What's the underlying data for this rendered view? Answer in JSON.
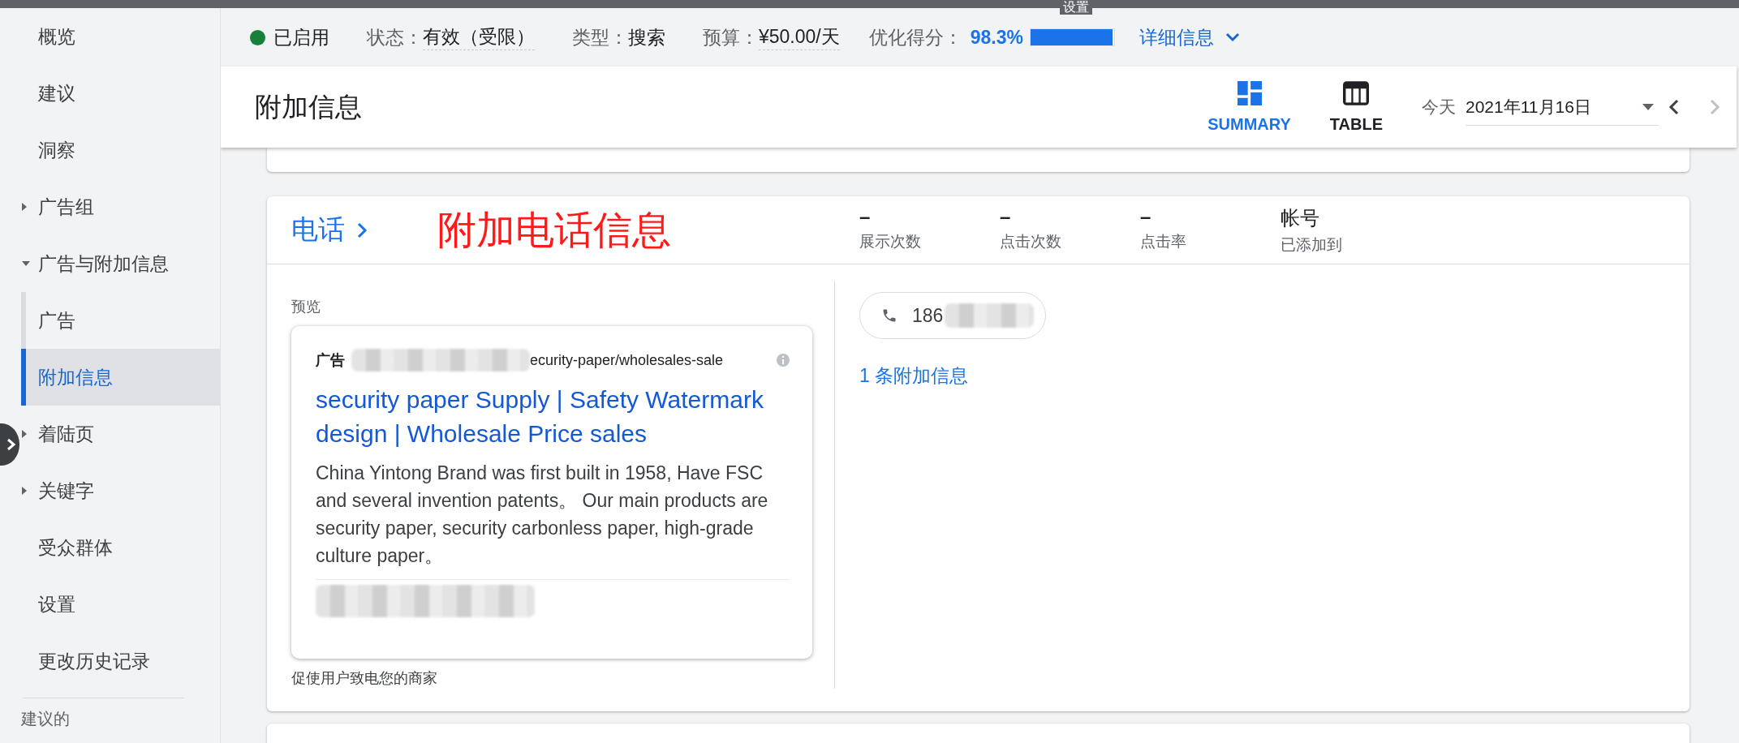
{
  "top_bar": {
    "title": "设置"
  },
  "sidebar": {
    "items": [
      {
        "label": "概览",
        "kind": "link",
        "selected": false
      },
      {
        "label": "建议",
        "kind": "link",
        "selected": false
      },
      {
        "label": "洞察",
        "kind": "link",
        "selected": false
      },
      {
        "label": "广告组",
        "kind": "group",
        "expanded": false
      },
      {
        "label": "广告与附加信息",
        "kind": "group",
        "expanded": true,
        "children": [
          {
            "label": "广告",
            "selected": false
          },
          {
            "label": "附加信息",
            "selected": true
          }
        ]
      },
      {
        "label": "着陆页",
        "kind": "group",
        "expanded": false
      },
      {
        "label": "关键字",
        "kind": "group",
        "expanded": false
      },
      {
        "label": "受众群体",
        "kind": "link",
        "selected": false
      },
      {
        "label": "设置",
        "kind": "link",
        "selected": false
      },
      {
        "label": "更改历史记录",
        "kind": "link",
        "selected": false
      }
    ],
    "section_label": "建议的"
  },
  "status_bar": {
    "enabled": true,
    "enabled_label": "已启用",
    "fields": [
      {
        "label": "状态：",
        "value": "有效（受限）",
        "underlined": true
      },
      {
        "label": "类型：",
        "value": "搜索",
        "underlined": false
      },
      {
        "label": "预算：",
        "value": "¥50.00/天",
        "underlined": true
      }
    ],
    "optimization": {
      "label": "优化得分：",
      "value": "98.3%",
      "level": 0.983
    },
    "details_link": "详细信息"
  },
  "header": {
    "title": "附加信息",
    "views": [
      {
        "label": "SUMMARY",
        "kind": "summary",
        "selected": true
      },
      {
        "label": "TABLE",
        "kind": "table",
        "selected": false
      }
    ],
    "date": {
      "label": "今天",
      "value": "2021年11月16日"
    }
  },
  "card": {
    "title": "电话",
    "annotation": "附加电话信息",
    "stats": [
      {
        "value": "–",
        "label": "展示次数"
      },
      {
        "value": "–",
        "label": "点击次数"
      },
      {
        "value": "–",
        "label": "点击率"
      },
      {
        "value": "帐号",
        "label": "已添加到"
      }
    ],
    "preview": {
      "label": "预览",
      "ad_badge": "广告",
      "url": "ecurity-paper/wholesales-sale",
      "headline": "security paper Supply | Safety Watermark design | Wholesale Price sales",
      "description": "China Yintong Brand was first built in 1958, Have FSC and several invention patents。 Our main products are security paper, security carbonless paper, high-grade culture paper。",
      "caption": "促使用户致电您的商家"
    },
    "phone": {
      "number": "186"
    },
    "extensions_link": "1 条附加信息"
  }
}
